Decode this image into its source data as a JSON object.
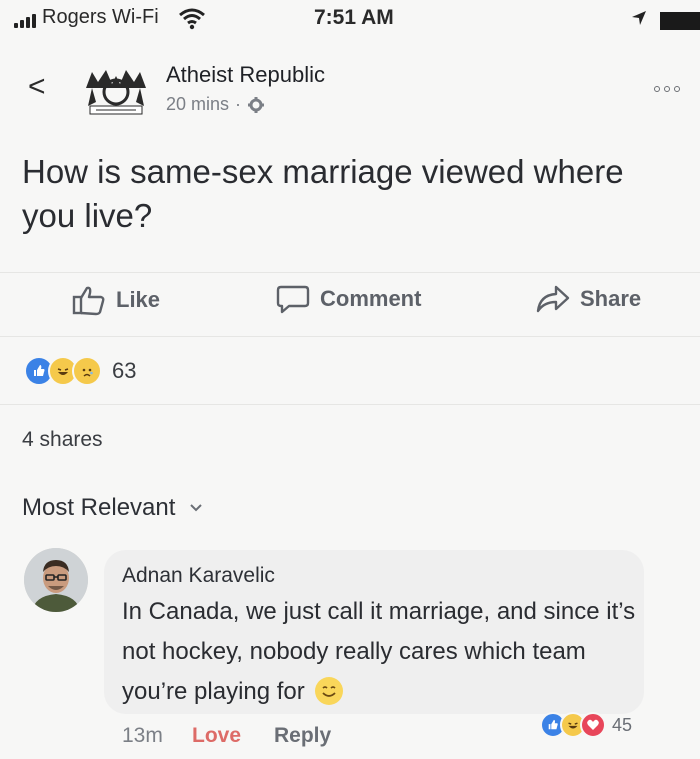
{
  "status_bar": {
    "carrier": "Rogers Wi-Fi",
    "time": "7:51 AM"
  },
  "post": {
    "page_name": "Atheist Republic",
    "time_ago": "20 mins",
    "separator": "·",
    "text": "How is same-sex marriage viewed where you live?",
    "actions": {
      "like": "Like",
      "comment": "Comment",
      "share": "Share"
    },
    "reaction_count": "63",
    "shares": "4 shares",
    "sort_label": "Most Relevant"
  },
  "comment": {
    "author": "Adnan Karavelic",
    "text": "In Canada, we just call it marriage, and since it’s not hockey, nobody really cares which team you’re playing for",
    "time_ago": "13m",
    "love_label": "Love",
    "reply_label": "Reply",
    "reaction_count": "45"
  },
  "colors": {
    "like_blue": "#3b82e6",
    "love_red": "#e8465a",
    "haha_yellow": "#f5c94b"
  }
}
